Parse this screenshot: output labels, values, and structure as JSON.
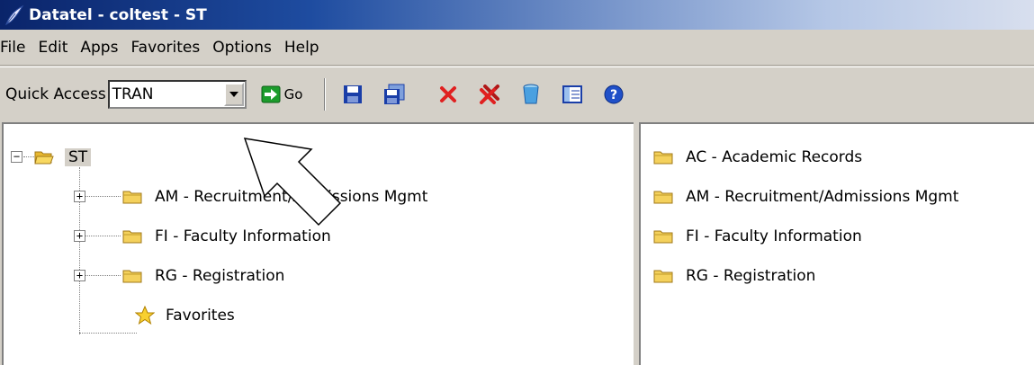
{
  "window": {
    "title": "Datatel - coltest - ST",
    "icon": "feather-icon"
  },
  "menu": [
    "File",
    "Edit",
    "Apps",
    "Favorites",
    "Options",
    "Help"
  ],
  "toolbar": {
    "quick_access_label": "Quick Access",
    "quick_access_value": "TRAN",
    "go_label": "Go",
    "icons": [
      "save-icon",
      "save-all-icon",
      "cancel-icon",
      "cancel-all-icon",
      "trash-icon",
      "panel-icon",
      "help-icon"
    ]
  },
  "tree": {
    "root_label": "ST",
    "children": [
      {
        "label": "AM - Recruitment/Admissions Mgmt"
      },
      {
        "label": "FI - Faculty Information"
      },
      {
        "label": "RG - Registration"
      }
    ],
    "favorites_label": "Favorites"
  },
  "list": [
    {
      "label": "AC - Academic Records"
    },
    {
      "label": "AM - Recruitment/Admissions Mgmt"
    },
    {
      "label": "FI - Faculty Information"
    },
    {
      "label": "RG - Registration"
    }
  ],
  "colors": {
    "title_bar_start": "#0a246a",
    "folder": "#f4d15c",
    "window_bg": "#d4d0c8"
  }
}
